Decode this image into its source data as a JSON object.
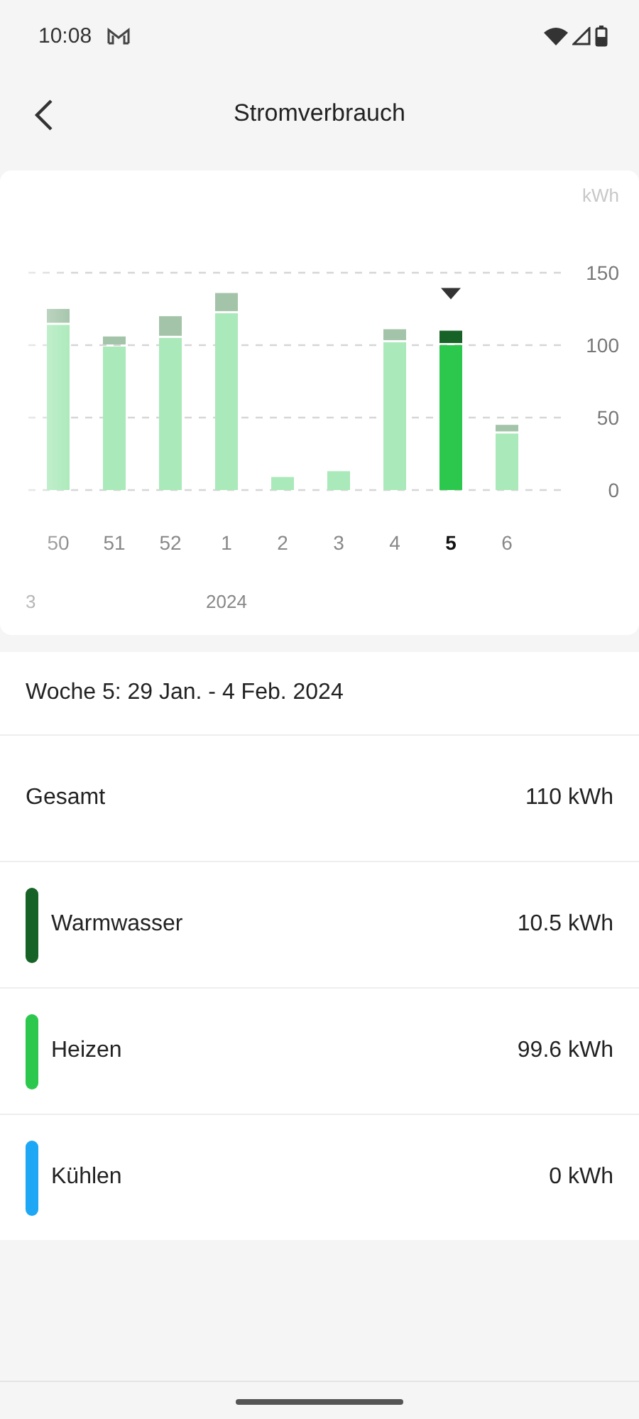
{
  "status_bar": {
    "time": "10:08"
  },
  "header": {
    "title": "Stromverbrauch"
  },
  "chart": {
    "bars": [
      {
        "selected": false,
        "year": "3"
      },
      {
        "selected": false
      },
      {
        "selected": false
      },
      {
        "selected": false,
        "year": "2024"
      },
      {
        "selected": false
      },
      {
        "selected": false
      },
      {
        "selected": false
      },
      {
        "selected": true
      },
      {
        "selected": false
      }
    ],
    "chart_data": {
      "type": "bar",
      "stacked": true,
      "ylabel": "kWh",
      "categories": [
        "50",
        "51",
        "52",
        "1",
        "2",
        "3",
        "4",
        "5",
        "6"
      ],
      "series": [
        {
          "color": "#aae9b9",
          "values": [
            114,
            99,
            105,
            122,
            9,
            13,
            102,
            null,
            39
          ]
        },
        {
          "color": "#a4c4a9",
          "values": [
            11,
            7,
            15,
            14,
            0,
            0,
            9,
            null,
            6
          ]
        },
        {
          "color": "#2cc84d",
          "values": [
            null,
            null,
            null,
            null,
            null,
            null,
            null,
            100,
            null
          ]
        },
        {
          "color": "#176327",
          "values": [
            null,
            null,
            null,
            null,
            null,
            null,
            null,
            10,
            null
          ]
        }
      ],
      "ylim": [
        0,
        150
      ],
      "yticks": [
        0,
        50,
        100,
        150
      ]
    }
  },
  "period": "Woche 5: 29 Jan. - 4 Feb. 2024",
  "rows": [
    {
      "kind": "total",
      "label": "Gesamt",
      "value": "110 kWh"
    },
    {
      "kind": "category",
      "label": "Warmwasser",
      "value": "10.5 kWh",
      "color": "#176327"
    },
    {
      "kind": "category",
      "label": "Heizen",
      "value": "99.6 kWh",
      "color": "#2cc84d"
    },
    {
      "kind": "category",
      "label": "Kühlen",
      "value": "0 kWh",
      "color": "#1ea7f5"
    }
  ]
}
